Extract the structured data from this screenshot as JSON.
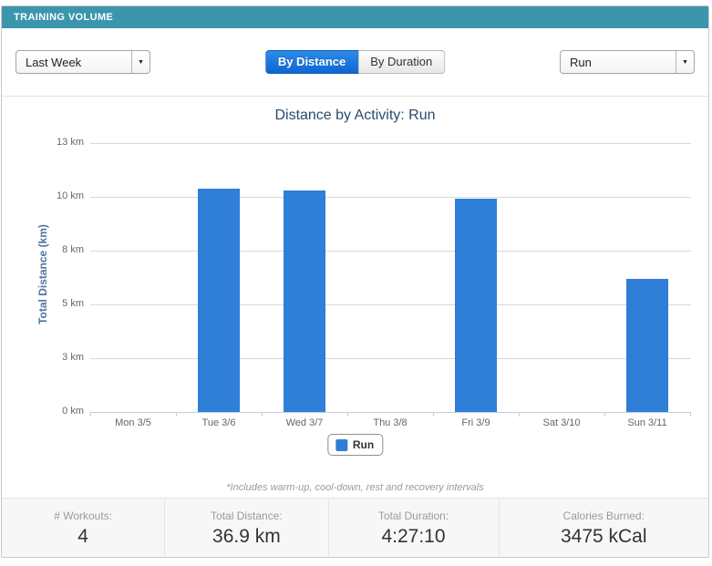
{
  "header": {
    "title": "TRAINING VOLUME"
  },
  "toolbar": {
    "period_select": {
      "value": "Last Week",
      "icon": "chevron-down-icon"
    },
    "toggle": [
      {
        "label": "By Distance",
        "active": true
      },
      {
        "label": "By Duration",
        "active": false
      }
    ],
    "activity_select": {
      "value": "Run",
      "icon": "chevron-down-icon"
    }
  },
  "chart_data": {
    "type": "bar",
    "title": "Distance by Activity: Run",
    "ylabel": "Total Distance (km)",
    "xlabel": "",
    "categories": [
      "Mon 3/5",
      "Tue 3/6",
      "Wed 3/7",
      "Thu 3/8",
      "Fri 3/9",
      "Sat 3/10",
      "Sun 3/11"
    ],
    "series": [
      {
        "name": "Run",
        "color": "#2f7ed8",
        "values": [
          0,
          10.4,
          10.3,
          0,
          9.9,
          0,
          6.2
        ]
      }
    ],
    "ylim": [
      0,
      12.5
    ],
    "yticks": [
      {
        "value": 0,
        "label": "0 km"
      },
      {
        "value": 2.5,
        "label": "3 km"
      },
      {
        "value": 5,
        "label": "5 km"
      },
      {
        "value": 7.5,
        "label": "8 km"
      },
      {
        "value": 10,
        "label": "10 km"
      },
      {
        "value": 12.5,
        "label": "13 km"
      }
    ],
    "grid": true,
    "legend_position": "bottom-center"
  },
  "footnote": "*Includes warm-up, cool-down, rest and recovery intervals",
  "footer": {
    "stats": [
      {
        "label": "# Workouts:",
        "value": "4"
      },
      {
        "label": "Total Distance:",
        "value": "36.9 km"
      },
      {
        "label": "Total Duration:",
        "value": "4:27:10"
      },
      {
        "label": "Calories Burned:",
        "value": "3475 kCal"
      }
    ]
  },
  "colors": {
    "header_bg": "#3b96ad",
    "bar": "#2f7ed8",
    "active_button": "#1673d6",
    "title_text": "#274b6d",
    "yaxis_title_text": "#4d759e",
    "axis_label_text": "#666666",
    "gridline": "#d8d8d8",
    "axis_line": "#c0d0e0",
    "footer_bg": "#f7f7f7"
  }
}
